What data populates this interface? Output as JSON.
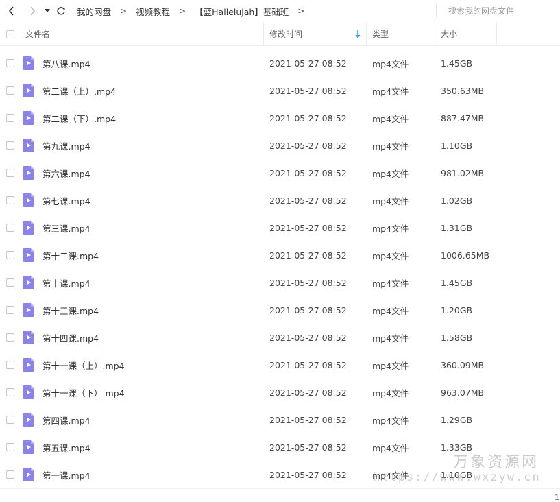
{
  "toolbar": {
    "back_icon": "chevron-left-icon",
    "forward_icon": "chevron-right-icon",
    "dropdown_icon": "caret-down-icon",
    "refresh_icon": "refresh-icon"
  },
  "breadcrumb": {
    "items": [
      "我的网盘",
      "视频教程",
      "【蓝Hallelujah】基础班"
    ],
    "separator": ">"
  },
  "search": {
    "placeholder": "搜索我的网盘文件"
  },
  "table": {
    "columns": {
      "name": "文件名",
      "modified": "修改时间",
      "type": "类型",
      "size": "大小"
    },
    "sort_icon": "arrow-down-icon",
    "sort_color": "#1e9fff",
    "file_icon_color": "#8b83e8",
    "rows": [
      {
        "name": "第八课.mp4",
        "modified": "2021-05-27 08:52",
        "type": "mp4文件",
        "size": "1.45GB"
      },
      {
        "name": "第二课（上）.mp4",
        "modified": "2021-05-27 08:52",
        "type": "mp4文件",
        "size": "350.63MB"
      },
      {
        "name": "第二课（下）.mp4",
        "modified": "2021-05-27 08:52",
        "type": "mp4文件",
        "size": "887.47MB"
      },
      {
        "name": "第九课.mp4",
        "modified": "2021-05-27 08:52",
        "type": "mp4文件",
        "size": "1.10GB"
      },
      {
        "name": "第六课.mp4",
        "modified": "2021-05-27 08:52",
        "type": "mp4文件",
        "size": "981.02MB"
      },
      {
        "name": "第七课.mp4",
        "modified": "2021-05-27 08:52",
        "type": "mp4文件",
        "size": "1.02GB"
      },
      {
        "name": "第三课.mp4",
        "modified": "2021-05-27 08:52",
        "type": "mp4文件",
        "size": "1.31GB"
      },
      {
        "name": "第十二课.mp4",
        "modified": "2021-05-27 08:52",
        "type": "mp4文件",
        "size": "1006.65MB"
      },
      {
        "name": "第十课.mp4",
        "modified": "2021-05-27 08:52",
        "type": "mp4文件",
        "size": "1.45GB"
      },
      {
        "name": "第十三课.mp4",
        "modified": "2021-05-27 08:52",
        "type": "mp4文件",
        "size": "1.20GB"
      },
      {
        "name": "第十四课.mp4",
        "modified": "2021-05-27 08:52",
        "type": "mp4文件",
        "size": "1.58GB"
      },
      {
        "name": "第十一课（上）.mp4",
        "modified": "2021-05-27 08:52",
        "type": "mp4文件",
        "size": "360.09MB"
      },
      {
        "name": "第十一课（下）.mp4",
        "modified": "2021-05-27 08:52",
        "type": "mp4文件",
        "size": "963.07MB"
      },
      {
        "name": "第四课.mp4",
        "modified": "2021-05-27 08:52",
        "type": "mp4文件",
        "size": "1.29GB"
      },
      {
        "name": "第五课.mp4",
        "modified": "2021-05-27 08:52",
        "type": "mp4文件",
        "size": "1.33GB"
      },
      {
        "name": "第一课.mp4",
        "modified": "2021-05-27 08:52",
        "type": "mp4文件",
        "size": "1.10GB"
      }
    ]
  },
  "pagination": {
    "page": "1"
  },
  "watermark": {
    "name": "万象资源网",
    "url": "https://www.wxzyw.cn"
  }
}
